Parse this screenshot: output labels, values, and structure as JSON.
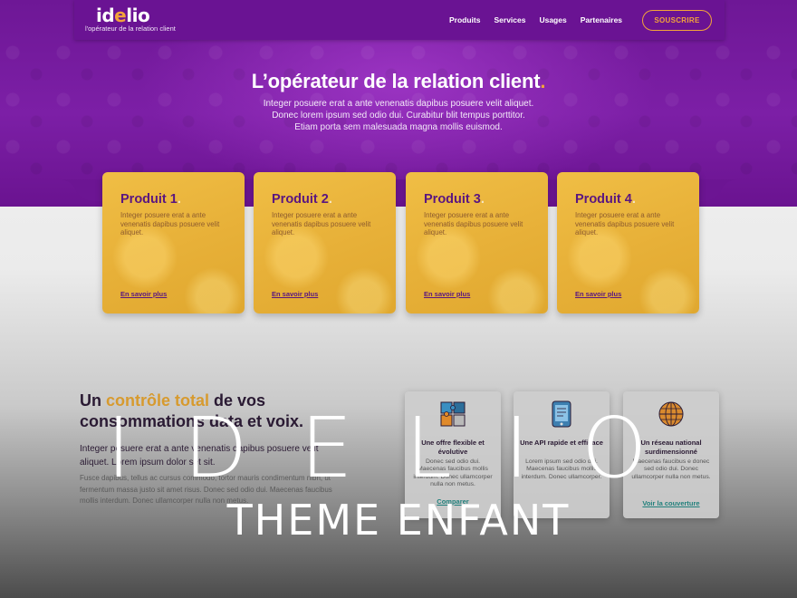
{
  "header": {
    "logo_prefix": "id",
    "logo_accent": "e",
    "logo_suffix": "lio",
    "tagline": "l'opérateur de la relation client",
    "nav": [
      "Produits",
      "Services",
      "Usages",
      "Partenaires"
    ],
    "cta_label": "SOUSCRIRE"
  },
  "hero": {
    "title": "L’opérateur de la relation client",
    "title_dot": ".",
    "lines": [
      "Integer posuere erat a ante venenatis dapibus posuere velit aliquet.",
      "Donec lorem ipsum sed odio dui. Curabitur blit tempus porttitor.",
      "Etiam porta sem malesuada magna mollis euismod."
    ]
  },
  "products": [
    {
      "title": "Produit 1",
      "dot": ".",
      "text": "Integer posuere erat a ante venenatis dapibus posuere velit aliquet.",
      "link": "En savoir plus"
    },
    {
      "title": "Produit 2",
      "dot": ".",
      "text": "Integer posuere erat a ante venenatis dapibus posuere velit aliquet.",
      "link": "En savoir plus"
    },
    {
      "title": "Produit 3",
      "dot": ".",
      "text": "Integer posuere erat a ante venenatis dapibus posuere velit aliquet.",
      "link": "En savoir plus"
    },
    {
      "title": "Produit 4",
      "dot": ".",
      "text": "Integer posuere erat a ante venenatis dapibus posuere velit aliquet.",
      "link": "En savoir plus"
    }
  ],
  "control": {
    "title_before": "Un ",
    "title_highlight": "contrôle total",
    "title_after": " de vos consommations data et voix.",
    "lead": "Integer posuere erat a ante venenatis dapibus posuere velit aliquet. Lorem ipsum dolor set sit.",
    "body": "Fusce dapibus, tellus ac cursus commodo, tortor mauris condimentum nibh, ut fermentum massa justo sit amet risus. Donec sed odio dui. Maecenas faucibus mollis interdum. Donec ullamcorper nulla non metus."
  },
  "features": [
    {
      "icon": "puzzle-icon",
      "title": "Une offre flexible et évolutive",
      "text": "Donec sed odio dui. Maecenas faucibus mollis interdum. Donec ullamcorper nulla non metus.",
      "link": "Comparer"
    },
    {
      "icon": "tablet-icon",
      "title": "Une API rapide et efficace",
      "text": "Lorem ipsum sed odio dui. Maecenas faucibus mollis interdum. Donec ullamcorper.",
      "link": ""
    },
    {
      "icon": "globe-icon",
      "title": "Un réseau national surdimensionné",
      "text": "Maecenas faucibus e donec sed odio dui. Donec ullamcorper nulla non metus.",
      "link": "Voir la couverture"
    }
  ],
  "overlay": {
    "title": "IDELIO",
    "subtitle": "THEME ENFANT"
  },
  "colors": {
    "purple": "#6e1796",
    "orange": "#f2a33a",
    "card_yellow": "#e7b038",
    "link_teal": "#21807c"
  }
}
